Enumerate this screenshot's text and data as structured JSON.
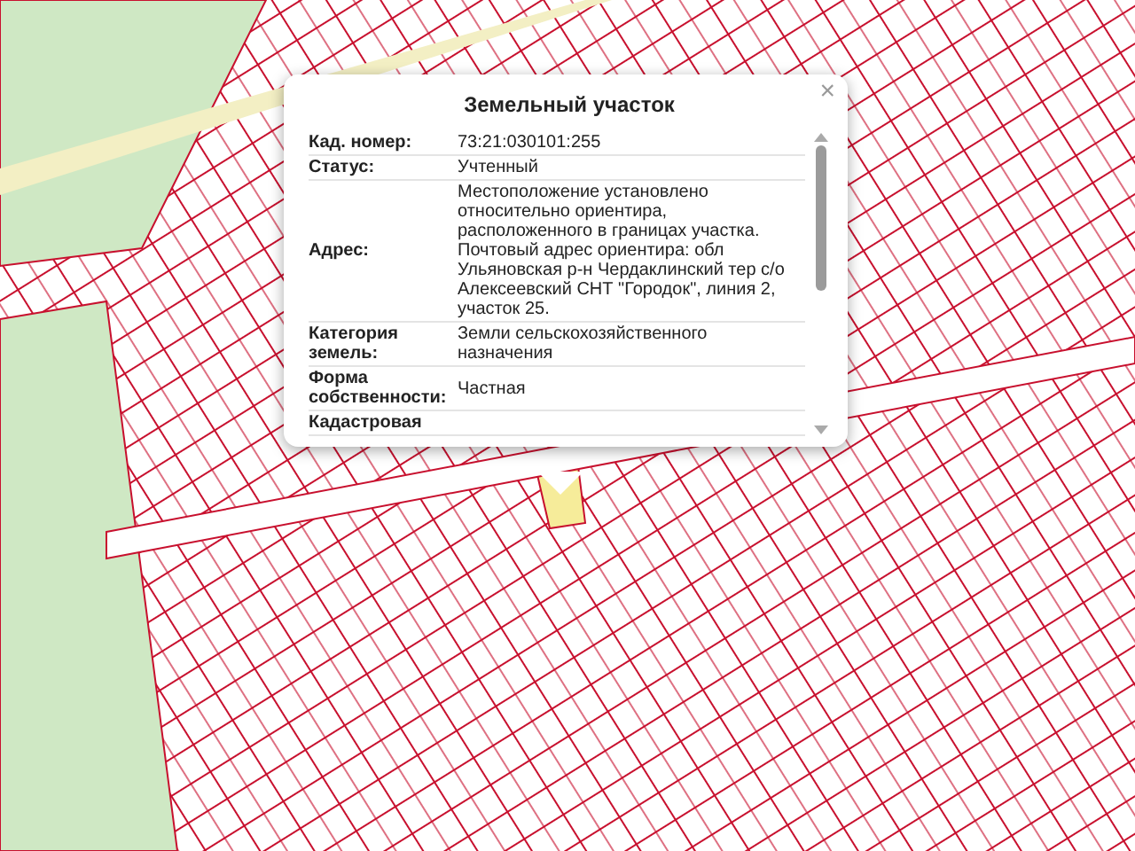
{
  "popup": {
    "title": "Земельный участок",
    "close": "×",
    "rows": [
      {
        "label": "Кад. номер:",
        "value": "73:21:030101:255"
      },
      {
        "label": "Статус:",
        "value": "Учтенный"
      },
      {
        "label": "Адрес:",
        "value": "Местоположение установлено относительно ориентира, расположенного в границах участка. Почтовый адрес ориентира: обл Ульяновская р-н Чердаклинский тер с/о Алексеевский СНТ \"Городок\", линия 2, участок 25."
      },
      {
        "label": "Категория земель:",
        "value": "Земли сельскохозяйственного назначения"
      },
      {
        "label": "Форма собственности:",
        "value": "Частная"
      },
      {
        "label": "Кадастровая",
        "value": ""
      }
    ]
  }
}
